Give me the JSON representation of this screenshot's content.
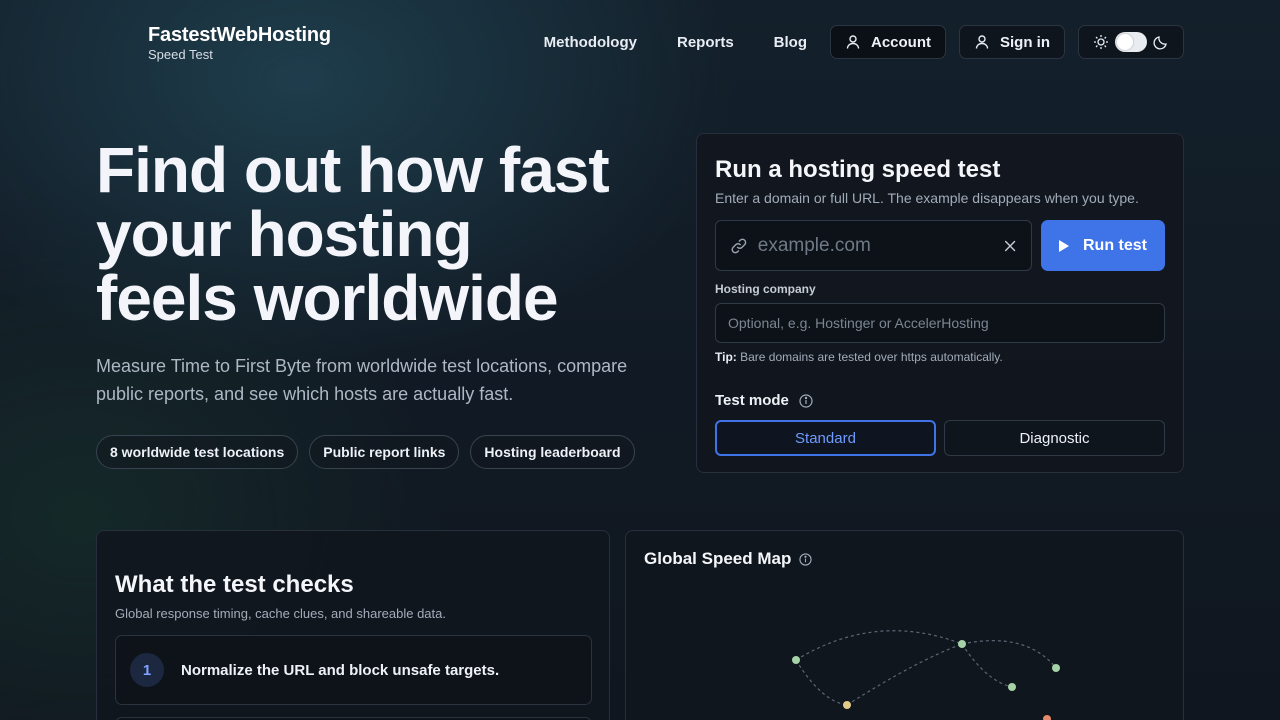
{
  "brand": {
    "name": "FastestWebHosting",
    "sub": "Speed Test"
  },
  "nav": {
    "links": [
      "Methodology",
      "Reports",
      "Blog"
    ],
    "account_label": "Account",
    "signin_label": "Sign in"
  },
  "hero": {
    "title_line1": "Find out how fast",
    "title_line2": "your hosting",
    "title_line3": "feels worldwide",
    "description": "Measure Time to First Byte from worldwide test locations, compare public reports, and see which hosts are actually fast.",
    "chips": [
      "8 worldwide test locations",
      "Public report links",
      "Hosting leaderboard"
    ]
  },
  "speed_test": {
    "title": "Run a hosting speed test",
    "subtitle": "Enter a domain or full URL. The example disappears when you type.",
    "url_placeholder": "example.com",
    "run_label": "Run test",
    "company_label": "Hosting company",
    "company_placeholder": "Optional, e.g. Hostinger or AccelerHosting",
    "tip_label": "Tip:",
    "tip_text": "Bare domains are tested over https automatically.",
    "mode_label": "Test mode",
    "modes": [
      "Standard",
      "Diagnostic"
    ],
    "selected_mode": "Standard"
  },
  "checks": {
    "title": "What the test checks",
    "subtitle": "Global response timing, cache clues, and shareable data.",
    "steps": [
      {
        "num": "1",
        "text": "Normalize the URL and block unsafe targets."
      }
    ]
  },
  "map": {
    "title": "Global Speed Map",
    "node_colors": [
      "#a6d2a8",
      "#a6d2a8",
      "#a6d2a8",
      "#a6d2a8",
      "#e3c98a",
      "#e58a6a"
    ]
  },
  "colors": {
    "accent": "#3f73e8",
    "accent_text": "#6f9bff"
  },
  "icons": [
    "user-icon",
    "sun-icon",
    "moon-icon",
    "link-icon",
    "clear-icon",
    "play-icon",
    "info-icon"
  ]
}
